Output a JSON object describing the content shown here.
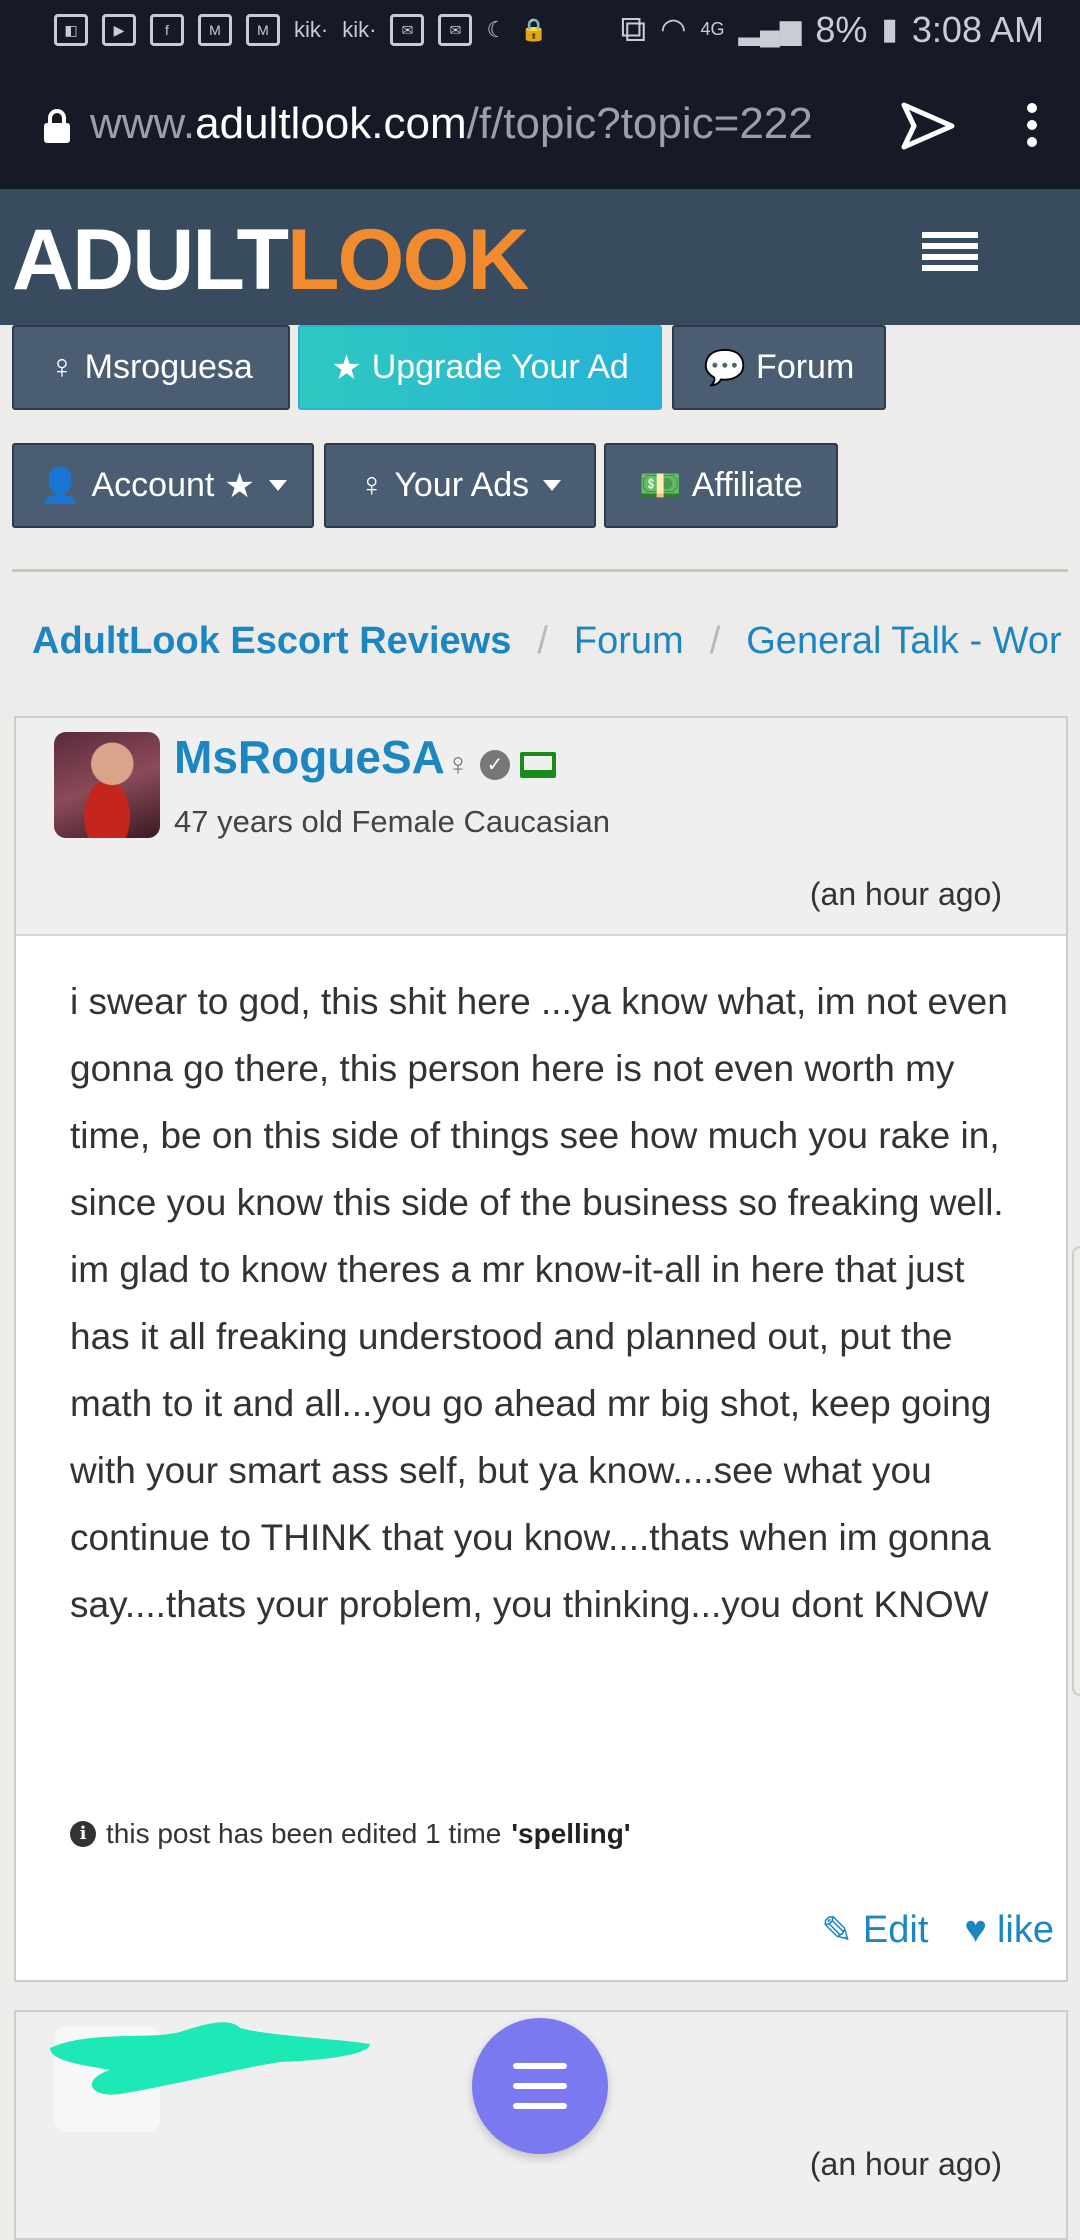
{
  "status_bar": {
    "left_icons": [
      "meme-icon",
      "video-icon",
      "facebook-icon",
      "gmail-icon",
      "gmail-icon",
      "kik-icon",
      "kik-icon",
      "mail-icon",
      "mail-icon",
      "moon-icon",
      "lock-notif-icon"
    ],
    "kik_label": "kik·",
    "network": "4G",
    "battery": "8%",
    "time": "3:08 AM"
  },
  "browser": {
    "url_prefix": "www.",
    "url_host": "adultlook.com",
    "url_path": "/f/topic?topic=222"
  },
  "header": {
    "logo_part1": "ADULT",
    "logo_part2": "LOOK"
  },
  "nav": {
    "row1": [
      {
        "label": "Msroguesa",
        "icon": "female-icon"
      },
      {
        "label": "Upgrade Your Ad",
        "icon": "star-icon"
      },
      {
        "label": "Forum",
        "icon": "comments-icon"
      }
    ],
    "row2": [
      {
        "label": "Account",
        "icon": "user-icon"
      },
      {
        "label": "Your Ads",
        "icon": "female-icon"
      },
      {
        "label": "Affiliate",
        "icon": "money-icon"
      }
    ]
  },
  "breadcrumb": {
    "items": [
      "AdultLook Escort Reviews",
      "Forum",
      "General Talk - Wor"
    ],
    "separator": "/"
  },
  "post": {
    "username": "MsRogueSA",
    "meta": "47 years old Female Caucasian",
    "time": "(an hour ago)",
    "body": "i swear to god, this shit here ...ya know what, im not even gonna go there, this person here is not even worth my time, be on this side of things see how much you rake in, since you know this side of the business so freaking well. im glad to know theres a mr know-it-all in here that just has it all freaking understood and planned out, put the math to it and all...you go ahead mr big shot, keep going with your smart ass self, but ya know....see what you continue to THINK that you know....thats when im gonna say....thats your problem, you thinking...you dont KNOW",
    "edited_prefix": "this post has been edited 1 time",
    "edited_reason": "'spelling'",
    "edit_label": "Edit",
    "like_label": "like"
  },
  "post2": {
    "time": "(an hour ago)"
  },
  "colors": {
    "link": "#1c86c2",
    "header_bg": "#394b5f",
    "logo_orange": "#f28a2e",
    "fab": "#7b79f0",
    "scribble": "#1de9b6"
  }
}
